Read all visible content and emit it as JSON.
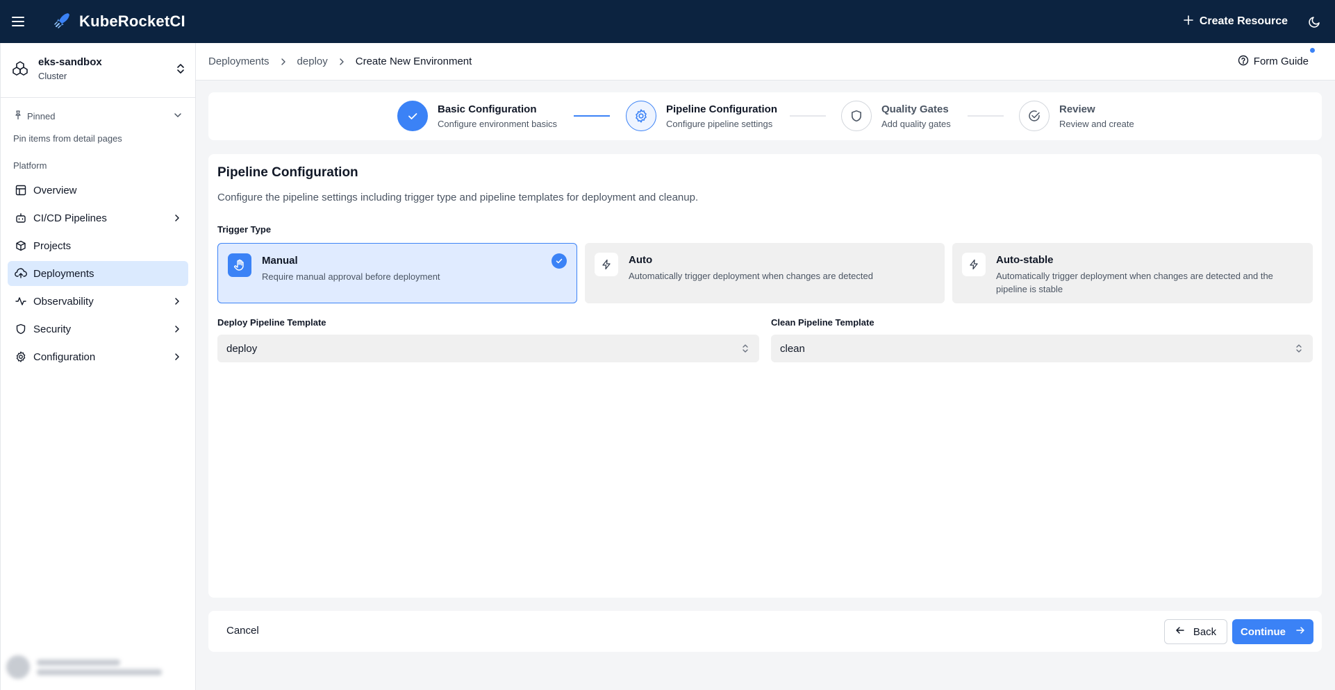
{
  "app": {
    "title": "KubeRocketCI"
  },
  "topbar": {
    "create_label": "Create Resource"
  },
  "cluster": {
    "name": "eks-sandbox",
    "type": "Cluster"
  },
  "sidebar": {
    "pinned_label": "Pinned",
    "pinned_hint": "Pin items from detail pages",
    "section_label": "Platform",
    "items": [
      {
        "label": "Overview",
        "icon": "layout-icon"
      },
      {
        "label": "CI/CD Pipelines",
        "icon": "bot-icon",
        "has_submenu": true
      },
      {
        "label": "Projects",
        "icon": "box-icon"
      },
      {
        "label": "Deployments",
        "icon": "cloud-upload-icon",
        "active": true
      },
      {
        "label": "Observability",
        "icon": "activity-icon",
        "has_submenu": true
      },
      {
        "label": "Security",
        "icon": "shield-icon",
        "has_submenu": true
      },
      {
        "label": "Configuration",
        "icon": "gear-icon",
        "has_submenu": true
      }
    ]
  },
  "breadcrumb": [
    "Deployments",
    "deploy",
    "Create New Environment"
  ],
  "header": {
    "form_guide_label": "Form Guide"
  },
  "stepper": {
    "steps": [
      {
        "title": "Basic Configuration",
        "subtitle": "Configure environment basics",
        "state": "done"
      },
      {
        "title": "Pipeline Configuration",
        "subtitle": "Configure pipeline settings",
        "state": "active"
      },
      {
        "title": "Quality Gates",
        "subtitle": "Add quality gates",
        "state": "pending"
      },
      {
        "title": "Review",
        "subtitle": "Review and create",
        "state": "pending"
      }
    ]
  },
  "form": {
    "title": "Pipeline Configuration",
    "description": "Configure the pipeline settings including trigger type and pipeline templates for deployment and cleanup.",
    "trigger_type_label": "Trigger Type",
    "trigger_options": [
      {
        "title": "Manual",
        "description": "Require manual approval before deployment",
        "selected": true,
        "icon": "hand-icon"
      },
      {
        "title": "Auto",
        "description": "Automatically trigger deployment when changes are detected",
        "selected": false,
        "icon": "zap-icon"
      },
      {
        "title": "Auto-stable",
        "description": "Automatically trigger deployment when changes are detected and the pipeline is stable",
        "selected": false,
        "icon": "zap-icon"
      }
    ],
    "deploy_template_label": "Deploy Pipeline Template",
    "deploy_template_value": "deploy",
    "clean_template_label": "Clean Pipeline Template",
    "clean_template_value": "clean"
  },
  "footer": {
    "cancel_label": "Cancel",
    "back_label": "Back",
    "continue_label": "Continue"
  },
  "colors": {
    "topbar": "#0c2340",
    "accent": "#3b82f6",
    "active_nav": "#dbeafe",
    "selected_card": "#e0ebff"
  }
}
